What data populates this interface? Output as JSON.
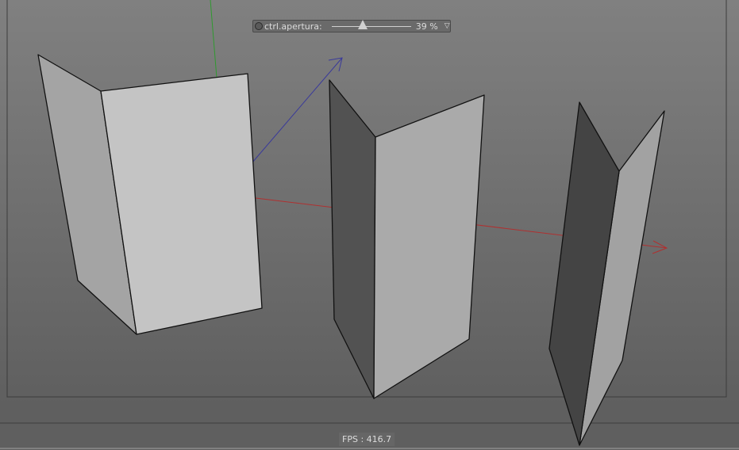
{
  "control": {
    "label": "ctrl.apertura:",
    "value_percent": 39,
    "value_text": "39 %",
    "dropdown_icon": "triangle-down-icon"
  },
  "status": {
    "fps_label": "FPS : 416.7"
  },
  "colors": {
    "x_axis": "#b03030",
    "y_axis": "#2f9a2f",
    "z_axis": "#3a3a9a",
    "background_top": "#808080",
    "background_bottom": "#5f5f5f"
  }
}
